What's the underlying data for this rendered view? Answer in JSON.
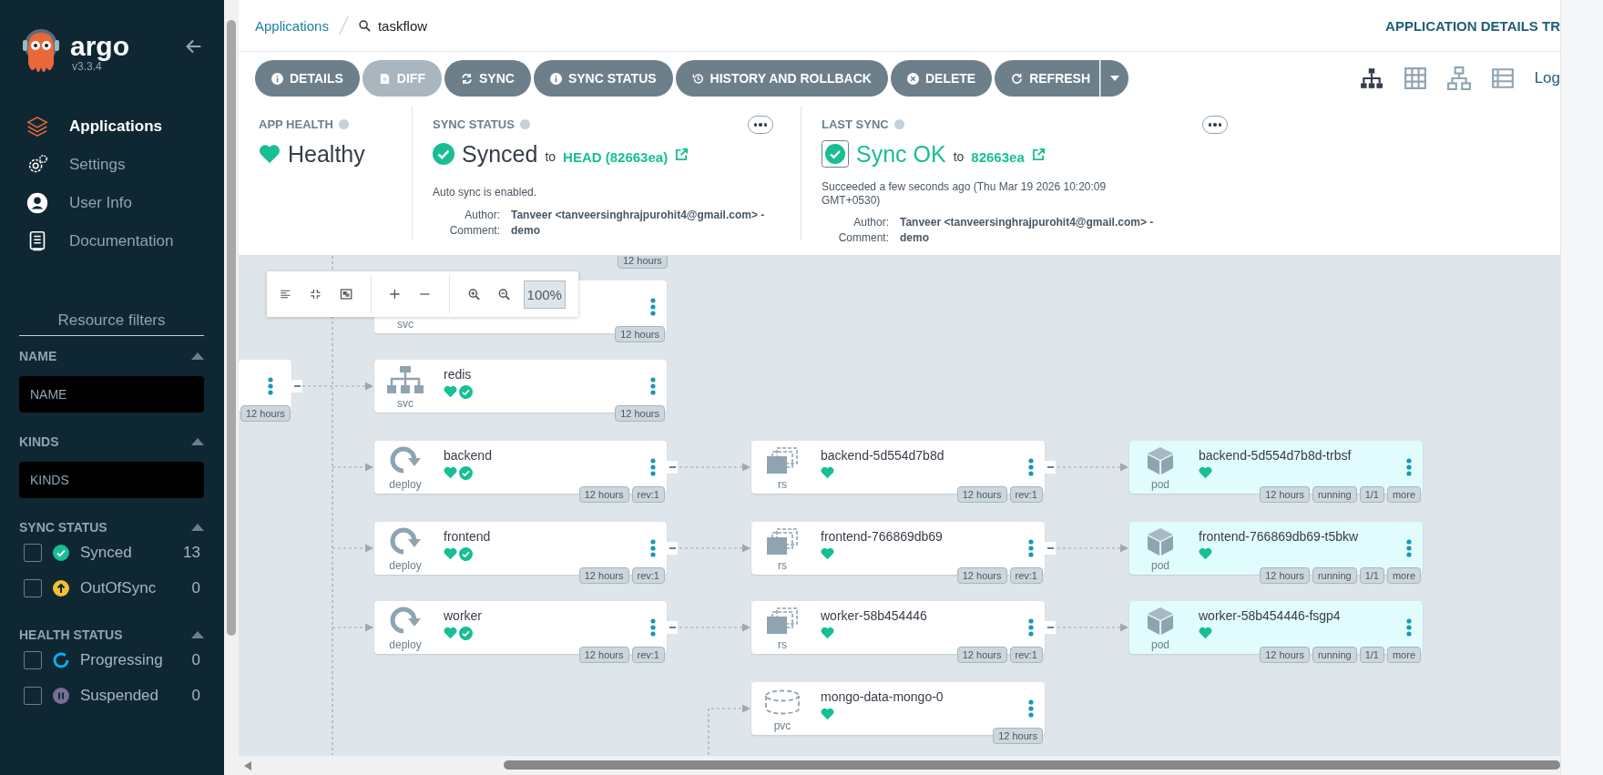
{
  "sidebar": {
    "logo_text": "argo",
    "version": "v3.3.4",
    "nav": [
      {
        "kind": "apps",
        "label": "Applications",
        "selected": true
      },
      {
        "kind": "settings",
        "label": "Settings",
        "selected": false
      },
      {
        "kind": "user",
        "label": "User Info",
        "selected": false
      },
      {
        "kind": "docs",
        "label": "Documentation",
        "selected": false
      }
    ],
    "filters_title": "Resource filters",
    "filters": [
      {
        "kind": "text",
        "title": "NAME",
        "placeholder": "NAME"
      },
      {
        "kind": "text",
        "title": "KINDS",
        "placeholder": "KINDS"
      },
      {
        "kind": "checks",
        "title": "SYNC STATUS",
        "options": [
          {
            "kind": "synced",
            "label": "Synced",
            "count": "13",
            "checked": false,
            "color": "#18be94"
          },
          {
            "kind": "outofsync",
            "label": "OutOfSync",
            "count": "0",
            "checked": false,
            "color": "#f4c030"
          }
        ]
      },
      {
        "kind": "checks",
        "title": "HEALTH STATUS",
        "options": [
          {
            "kind": "progressing",
            "label": "Progressing",
            "count": "0",
            "checked": false,
            "color": "#0dadea"
          },
          {
            "kind": "suspended",
            "label": "Suspended",
            "count": "0",
            "checked": false,
            "color": "#766f94"
          }
        ]
      }
    ]
  },
  "breadcrumb": {
    "parent": "Applications",
    "current": "taskflow"
  },
  "page_title": "APPLICATION DETAILS TR",
  "actions": [
    {
      "kind": "info",
      "label": "DETAILS",
      "disabled": false
    },
    {
      "kind": "diff",
      "label": "DIFF",
      "disabled": true
    },
    {
      "kind": "sync",
      "label": "SYNC",
      "disabled": false
    },
    {
      "kind": "info",
      "label": "SYNC STATUS",
      "disabled": false
    },
    {
      "kind": "history",
      "label": "HISTORY AND ROLLBACK",
      "disabled": false
    },
    {
      "kind": "delete",
      "label": "DELETE",
      "disabled": false
    },
    {
      "kind": "refresh",
      "label": "REFRESH",
      "disabled": false
    }
  ],
  "views": [
    {
      "kind": "tree",
      "selected": true
    },
    {
      "kind": "grid",
      "selected": false
    },
    {
      "kind": "network",
      "selected": false
    },
    {
      "kind": "list",
      "selected": false
    }
  ],
  "logs_link": "Log",
  "status": {
    "app_health": {
      "title": "APP HEALTH",
      "value": "Healthy"
    },
    "sync_status": {
      "title": "SYNC STATUS",
      "value": "Synced",
      "to": "to",
      "revision": "HEAD (82663ea)",
      "note": "Auto sync is enabled.",
      "author_label": "Author:",
      "author": "Tanveer <tanveersinghrajpurohit4@gmail.com> -",
      "comment_label": "Comment:",
      "comment": "demo"
    },
    "last_sync": {
      "title": "LAST SYNC",
      "value": "Sync OK",
      "to": "to",
      "revision": "82663ea",
      "note": "Succeeded a few seconds ago (Thu Mar 19 2026 10:20:09 GMT+0530)",
      "author_label": "Author:",
      "author": "Tanveer <tanveersinghrajpurohit4@gmail.com> -",
      "comment_label": "Comment:",
      "comment": "demo"
    }
  },
  "zoom_level": "100%",
  "graph": {
    "top_badge": "12 hours",
    "nodes": [
      {
        "kind": "partial",
        "badges": [
          "12 hours"
        ],
        "collapsible": true
      },
      {
        "kind": "svc",
        "type": "svc",
        "badges": [
          "12 hours"
        ]
      },
      {
        "kind": "svc",
        "type": "svc",
        "name": "redis",
        "healthy": true,
        "synced": true,
        "badges": [
          "12 hours"
        ]
      },
      {
        "kind": "deploy",
        "type": "deploy",
        "name": "backend",
        "healthy": true,
        "synced": true,
        "badges": [
          "12 hours",
          "rev:1"
        ],
        "collapsible": true
      },
      {
        "kind": "deploy",
        "type": "deploy",
        "name": "frontend",
        "healthy": true,
        "synced": true,
        "badges": [
          "12 hours",
          "rev:1"
        ],
        "collapsible": true
      },
      {
        "kind": "deploy",
        "type": "deploy",
        "name": "worker",
        "healthy": true,
        "synced": true,
        "badges": [
          "12 hours",
          "rev:1"
        ],
        "collapsible": true
      },
      {
        "kind": "rs",
        "type": "rs",
        "name": "backend-5d554d7b8d",
        "healthy": true,
        "badges": [
          "12 hours",
          "rev:1"
        ],
        "collapsible": true
      },
      {
        "kind": "rs",
        "type": "rs",
        "name": "frontend-766869db69",
        "healthy": true,
        "badges": [
          "12 hours",
          "rev:1"
        ],
        "collapsible": true
      },
      {
        "kind": "rs",
        "type": "rs",
        "name": "worker-58b454446",
        "healthy": true,
        "badges": [
          "12 hours",
          "rev:1"
        ],
        "collapsible": true
      },
      {
        "kind": "pvc",
        "type": "pvc",
        "name": "mongo-data-mongo-0",
        "healthy": true,
        "badges": [
          "12 hours"
        ]
      },
      {
        "kind": "pod",
        "type": "pod",
        "name": "backend-5d554d7b8d-trbsf",
        "healthy": true,
        "badges": [
          "12 hours",
          "running",
          "1/1",
          "more"
        ]
      },
      {
        "kind": "pod",
        "type": "pod",
        "name": "frontend-766869db69-t5bkw",
        "healthy": true,
        "badges": [
          "12 hours",
          "running",
          "1/1",
          "more"
        ]
      },
      {
        "kind": "pod",
        "type": "pod",
        "name": "worker-58b454446-fsgp4",
        "healthy": true,
        "badges": [
          "12 hours",
          "running",
          "1/1",
          "more"
        ]
      }
    ]
  }
}
